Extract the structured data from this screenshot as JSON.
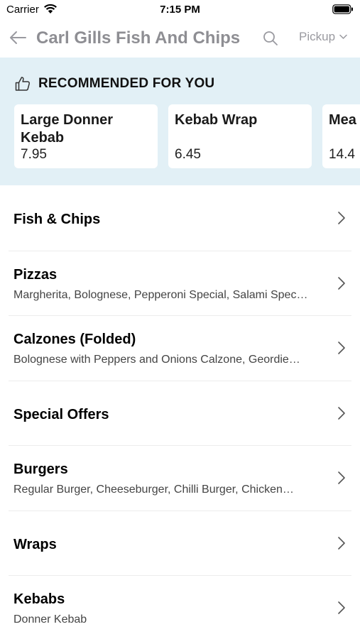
{
  "status": {
    "carrier": "Carrier",
    "time": "7:15 PM"
  },
  "nav": {
    "title": "Carl Gills Fish And Chips",
    "order_mode": "Pickup"
  },
  "recommended": {
    "heading": "RECOMMENDED FOR YOU",
    "items": [
      {
        "name": "Large Donner Kebab",
        "price": "7.95"
      },
      {
        "name": "Kebab Wrap",
        "price": "6.45"
      },
      {
        "name": "Mea",
        "price": "14.4"
      }
    ]
  },
  "categories": [
    {
      "name": "Fish & Chips",
      "desc": ""
    },
    {
      "name": "Pizzas",
      "desc": "Margherita, Bolognese, Pepperoni Special, Salami Spec…"
    },
    {
      "name": "Calzones (Folded)",
      "desc": "Bolognese with Peppers and Onions Calzone, Geordie…"
    },
    {
      "name": "Special Offers",
      "desc": ""
    },
    {
      "name": "Burgers",
      "desc": "Regular Burger, Cheeseburger, Chilli Burger, Chicken…"
    },
    {
      "name": "Wraps",
      "desc": ""
    },
    {
      "name": "Kebabs",
      "desc": "Donner Kebab"
    }
  ],
  "colors": {
    "banner_bg": "#e2f0f6",
    "title_gray": "#8e8e93"
  }
}
